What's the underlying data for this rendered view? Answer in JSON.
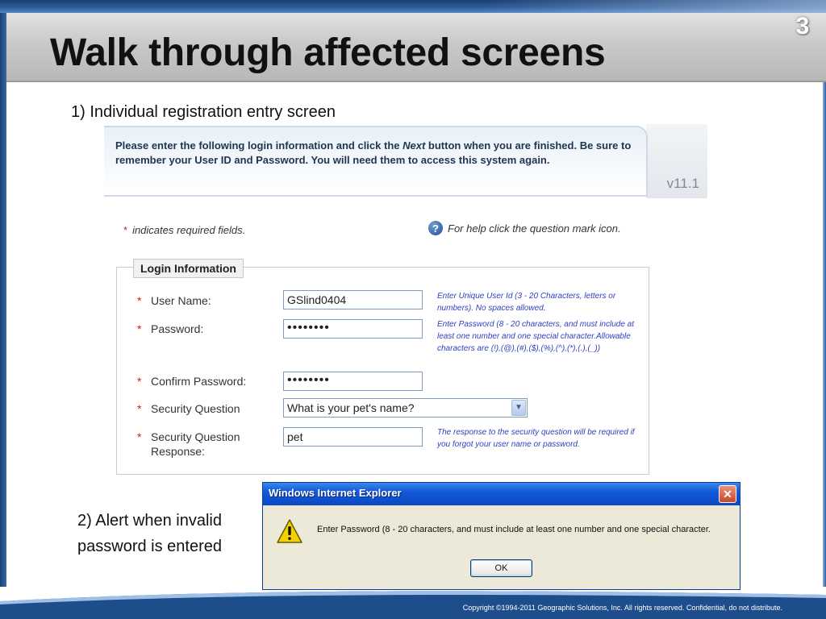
{
  "slide": {
    "page_number": "3",
    "title": "Walk through affected screens",
    "caption_1": "1) Individual registration entry screen",
    "caption_2": "2) Alert when invalid password is entered",
    "footer": "Copyright ©1994-2011 Geographic Solutions, Inc.  All rights reserved. Confidential, do not distribute."
  },
  "registration": {
    "version": "v11.1",
    "instructions_part1": "Please enter the following login information and click the ",
    "instructions_emph": "Next",
    "instructions_part2": " button when you are finished. Be sure to remember your User ID and Password. You will need them to access this system again.",
    "required_note": "indicates required fields.",
    "help_note": "For help click the question mark icon.",
    "help_icon": "question-mark-icon",
    "section_title": "Login Information",
    "fields": {
      "username": {
        "label": "User Name:",
        "value": "GSlind0404",
        "hint": "Enter Unique User Id (3 - 20 Characters, letters or numbers). No spaces allowed."
      },
      "password": {
        "label": "Password:",
        "value": "••••••••",
        "hint": "Enter Password (8 - 20 characters, and must include at least one number and one special character.Allowable characters are (!),(@),(#),($),(%),(^),(*),(.),(_))"
      },
      "confirm_password": {
        "label": "Confirm Password:",
        "value": "••••••••"
      },
      "security_question": {
        "label": "Security Question",
        "selected": "What is your pet's name?"
      },
      "security_response": {
        "label": "Security Question Response:",
        "value": "pet",
        "hint": "The response to the security question will be required if you forgot your user name or password."
      }
    }
  },
  "alert": {
    "title": "Windows Internet Explorer",
    "message": "Enter Password (8 - 20 characters, and must include at least one number and one special character.",
    "ok_label": "OK",
    "close_label": "✕",
    "icon": "warning-icon"
  },
  "colors": {
    "required": "#d01a1a",
    "hint_text": "#2f3fbf",
    "title_bar_blue": "#1259d8"
  }
}
